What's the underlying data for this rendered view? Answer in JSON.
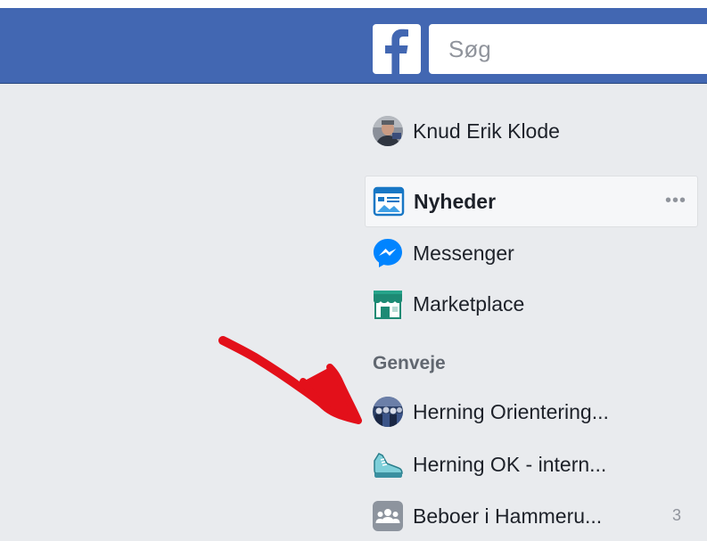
{
  "header": {
    "logo_icon": "facebook-f-icon",
    "search_placeholder": "Søg",
    "brand_color": "#4267b2"
  },
  "profile": {
    "name": "Knud Erik Klode",
    "avatar_icon": "user-avatar"
  },
  "nav": {
    "newsfeed_label": "Nyheder",
    "newsfeed_icon": "newsfeed-icon",
    "newsfeed_more": "•••",
    "messenger_label": "Messenger",
    "messenger_icon": "messenger-icon",
    "marketplace_label": "Marketplace",
    "marketplace_icon": "marketplace-shop-icon"
  },
  "shortcuts": {
    "title": "Genveje",
    "items": [
      {
        "label": "Herning Orientering...",
        "icon": "group-photo-icon"
      },
      {
        "label": "Herning OK - intern...",
        "icon": "running-shoe-icon"
      },
      {
        "label": "Beboer i Hammeru...",
        "icon": "group-people-icon",
        "count": "3"
      }
    ]
  },
  "annotation": {
    "arrow_color": "#e3101a"
  }
}
